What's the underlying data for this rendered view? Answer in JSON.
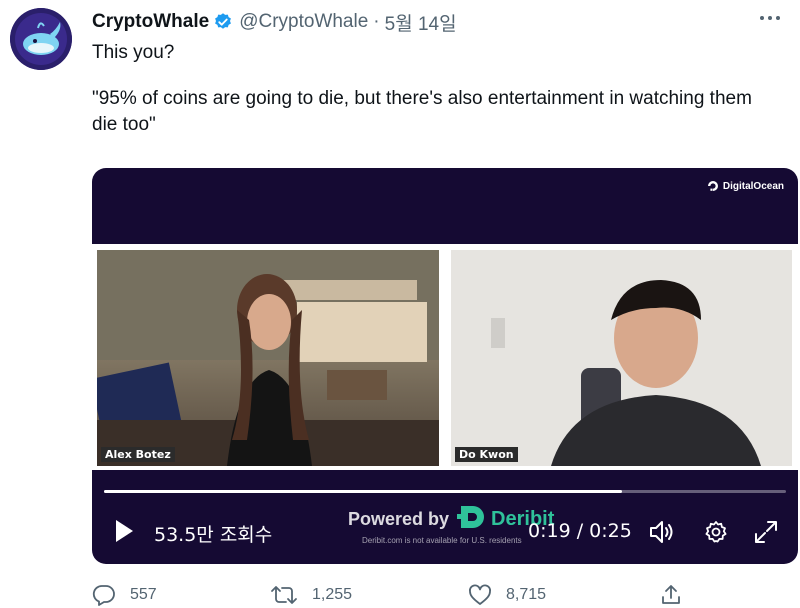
{
  "tweet": {
    "display_name": "CryptoWhale",
    "handle": "@CryptoWhale",
    "separator": "·",
    "date": "5월 14일",
    "text_line1": "This you?",
    "text_line2": "\"95% of coins are going to die, but there's also entertainment in watching them die too\""
  },
  "video": {
    "sponsor_logo_text": "DigitalOcean",
    "left_name_tag": "Alex Botez",
    "right_name_tag": "Do Kwon",
    "progress": 0.76,
    "views": "53.5만 조회수",
    "powered_by": "Powered by",
    "powered_brand": "Deribit",
    "disclaimer": "Deribit.com is not available for U.S. residents",
    "time": "0:19 / 0:25"
  },
  "actions": {
    "reply_count": "557",
    "retweet_count": "1,255",
    "like_count": "8,715"
  },
  "colors": {
    "verified_blue": "#1d9bf0",
    "video_bg": "#150a33",
    "deribit_green": "#2fc29a",
    "muted_text": "#536471"
  },
  "icons": [
    "verified-badge-icon",
    "more-icon",
    "digitalocean-icon",
    "play-icon",
    "deribit-icon",
    "volume-icon",
    "settings-icon",
    "fullscreen-icon",
    "reply-icon",
    "retweet-icon",
    "like-icon",
    "share-icon"
  ]
}
